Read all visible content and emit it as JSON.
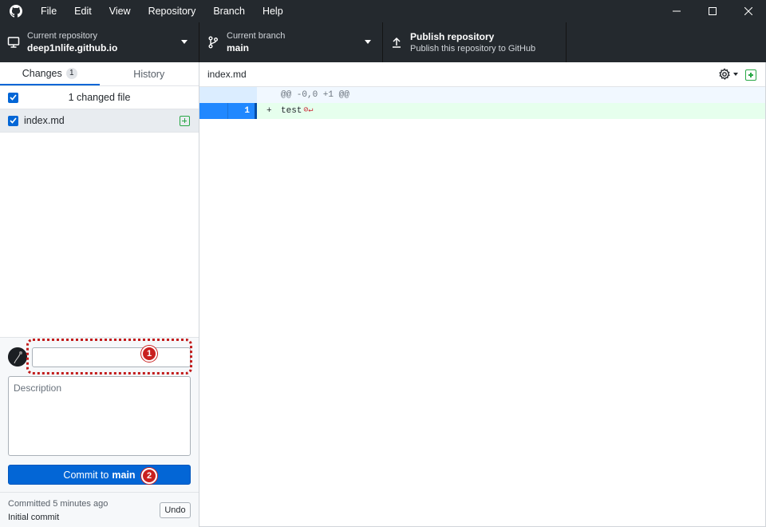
{
  "menu": [
    "File",
    "Edit",
    "View",
    "Repository",
    "Branch",
    "Help"
  ],
  "toolbar": {
    "repo_label": "Current repository",
    "repo_name": "deep1nlife.github.io",
    "branch_label": "Current branch",
    "branch_name": "main",
    "publish_title": "Publish repository",
    "publish_sub": "Publish this repository to GitHub"
  },
  "sidebar": {
    "tab_changes": "Changes",
    "changes_count": "1",
    "tab_history": "History",
    "changed_files_text": "1 changed file",
    "files": [
      {
        "name": "index.md",
        "status": "added"
      }
    ]
  },
  "commit": {
    "summary_value": "",
    "description_placeholder": "Description",
    "button_prefix": "Commit to",
    "button_branch": "main",
    "badge_1": "1",
    "badge_2": "2"
  },
  "last_commit": {
    "time_text": "Committed 5 minutes ago",
    "message": "Initial commit",
    "undo_label": "Undo"
  },
  "diff": {
    "filename": "index.md",
    "hunk_header": "@@ -0,0 +1 @@",
    "lines": [
      {
        "new_line": "1",
        "marker": "+",
        "text": "test"
      }
    ]
  },
  "colors": {
    "titlebar": "#24292e",
    "accent_blue": "#0366d6",
    "added_green": "#28a745",
    "annotation_red": "#c9201f",
    "diff_add_bg": "#e6ffed"
  },
  "icons": [
    "github-logo-icon",
    "minimize-icon",
    "maximize-icon",
    "close-icon",
    "computer-icon",
    "branch-icon",
    "upload-icon",
    "gear-icon",
    "plus-square-icon",
    "no-newline-icon"
  ]
}
